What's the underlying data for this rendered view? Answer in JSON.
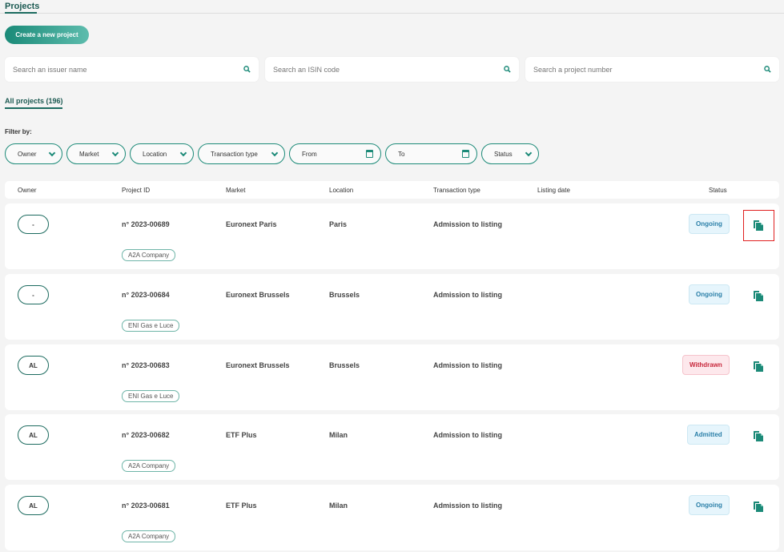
{
  "header": {
    "title": "Projects",
    "create_label": "Create a new project"
  },
  "search": {
    "issuer_placeholder": "Search an issuer name",
    "isin_placeholder": "Search an ISIN code",
    "project_placeholder": "Search a project number"
  },
  "tab": {
    "label": "All projects (196)"
  },
  "filters": {
    "label": "Filter by:",
    "owner": "Owner",
    "market": "Market",
    "location": "Location",
    "transaction_type": "Transaction type",
    "from": "From",
    "to": "To",
    "status": "Status"
  },
  "table": {
    "headers": {
      "owner": "Owner",
      "project_id": "Project ID",
      "market": "Market",
      "location": "Location",
      "transaction_type": "Transaction type",
      "listing_date": "Listing date",
      "status": "Status"
    },
    "rows": [
      {
        "owner": "-",
        "project_id": "n° 2023-00689",
        "market": "Euronext Paris",
        "location": "Paris",
        "transaction_type": "Admission to listing",
        "listing_date": "",
        "status": "Ongoing",
        "company": "A2A Company"
      },
      {
        "owner": "-",
        "project_id": "n° 2023-00684",
        "market": "Euronext Brussels",
        "location": "Brussels",
        "transaction_type": "Admission to listing",
        "listing_date": "",
        "status": "Ongoing",
        "company": "ENI Gas e Luce"
      },
      {
        "owner": "AL",
        "project_id": "n° 2023-00683",
        "market": "Euronext Brussels",
        "location": "Brussels",
        "transaction_type": "Admission to listing",
        "listing_date": "",
        "status": "Withdrawn",
        "company": "ENI Gas e Luce"
      },
      {
        "owner": "AL",
        "project_id": "n° 2023-00682",
        "market": "ETF Plus",
        "location": "Milan",
        "transaction_type": "Admission to listing",
        "listing_date": "",
        "status": "Admitted",
        "company": "A2A Company"
      },
      {
        "owner": "AL",
        "project_id": "n° 2023-00681",
        "market": "ETF Plus",
        "location": "Milan",
        "transaction_type": "Admission to listing",
        "listing_date": "",
        "status": "Ongoing",
        "company": "A2A Company"
      }
    ]
  },
  "colors": {
    "accent": "#1c8a78",
    "ongoing_bg": "#e6f5fc",
    "ongoing_text": "#2a7fa8",
    "withdrawn_bg": "#fde8ec",
    "withdrawn_text": "#c8283c"
  }
}
